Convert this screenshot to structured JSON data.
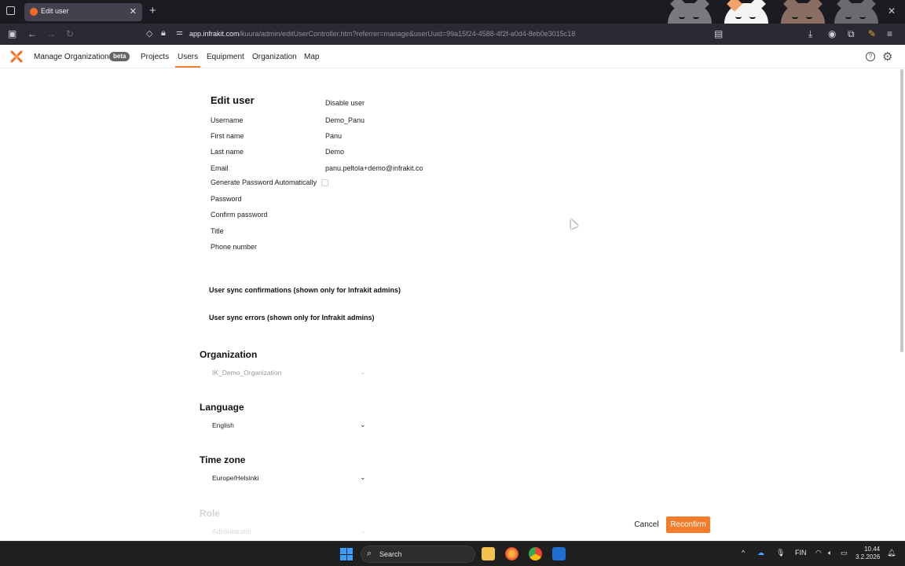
{
  "browser": {
    "tab_title": "Edit user",
    "url_host": "app.infrakit.com",
    "url_path": "/kuura/admin/editUserController.htm?referrer=manage&userUuid=99a15f24-4588-4f2f-a0d4-8eb0e3015c18"
  },
  "app_nav": {
    "manage_orgs": "Manage Organizations",
    "beta": "beta",
    "projects": "Projects",
    "users": "Users",
    "equipment": "Equipment",
    "organization": "Organization",
    "map": "Map",
    "help_glyph": "?"
  },
  "form": {
    "title": "Edit user",
    "disable_user": "Disable user",
    "fields": [
      {
        "label": "Username",
        "value": "Demo_Panu"
      },
      {
        "label": "First name",
        "value": "Panu"
      },
      {
        "label": "Last name",
        "value": "Demo"
      },
      {
        "label": "Email",
        "value": "panu.peltola+demo@infrakit.co"
      }
    ],
    "gen_password_label": "Generate Password Automatically",
    "password_label": "Password",
    "confirm_password_label": "Confirm password",
    "title_label": "Title",
    "phone_label": "Phone number",
    "sync_confirmations": "User sync confirmations (shown only for Infrakit admins)",
    "sync_errors": "User sync errors (shown only for Infrakit admins)",
    "organization_heading": "Organization",
    "organization_value": "IK_Demo_Organization",
    "language_heading": "Language",
    "language_value": "English",
    "timezone_heading": "Time zone",
    "timezone_value": "Europe/Helsinki",
    "role_heading": "Role",
    "role_value": "Administrator"
  },
  "actions": {
    "cancel": "Cancel",
    "reconfirm": "Reconfirm"
  },
  "taskbar": {
    "search": "Search",
    "lang": "FIN",
    "time": "10.44",
    "date": "3.2.2026"
  },
  "colors": {
    "accent": "#f57c2a",
    "chrome_dark": "#1c1b22"
  }
}
